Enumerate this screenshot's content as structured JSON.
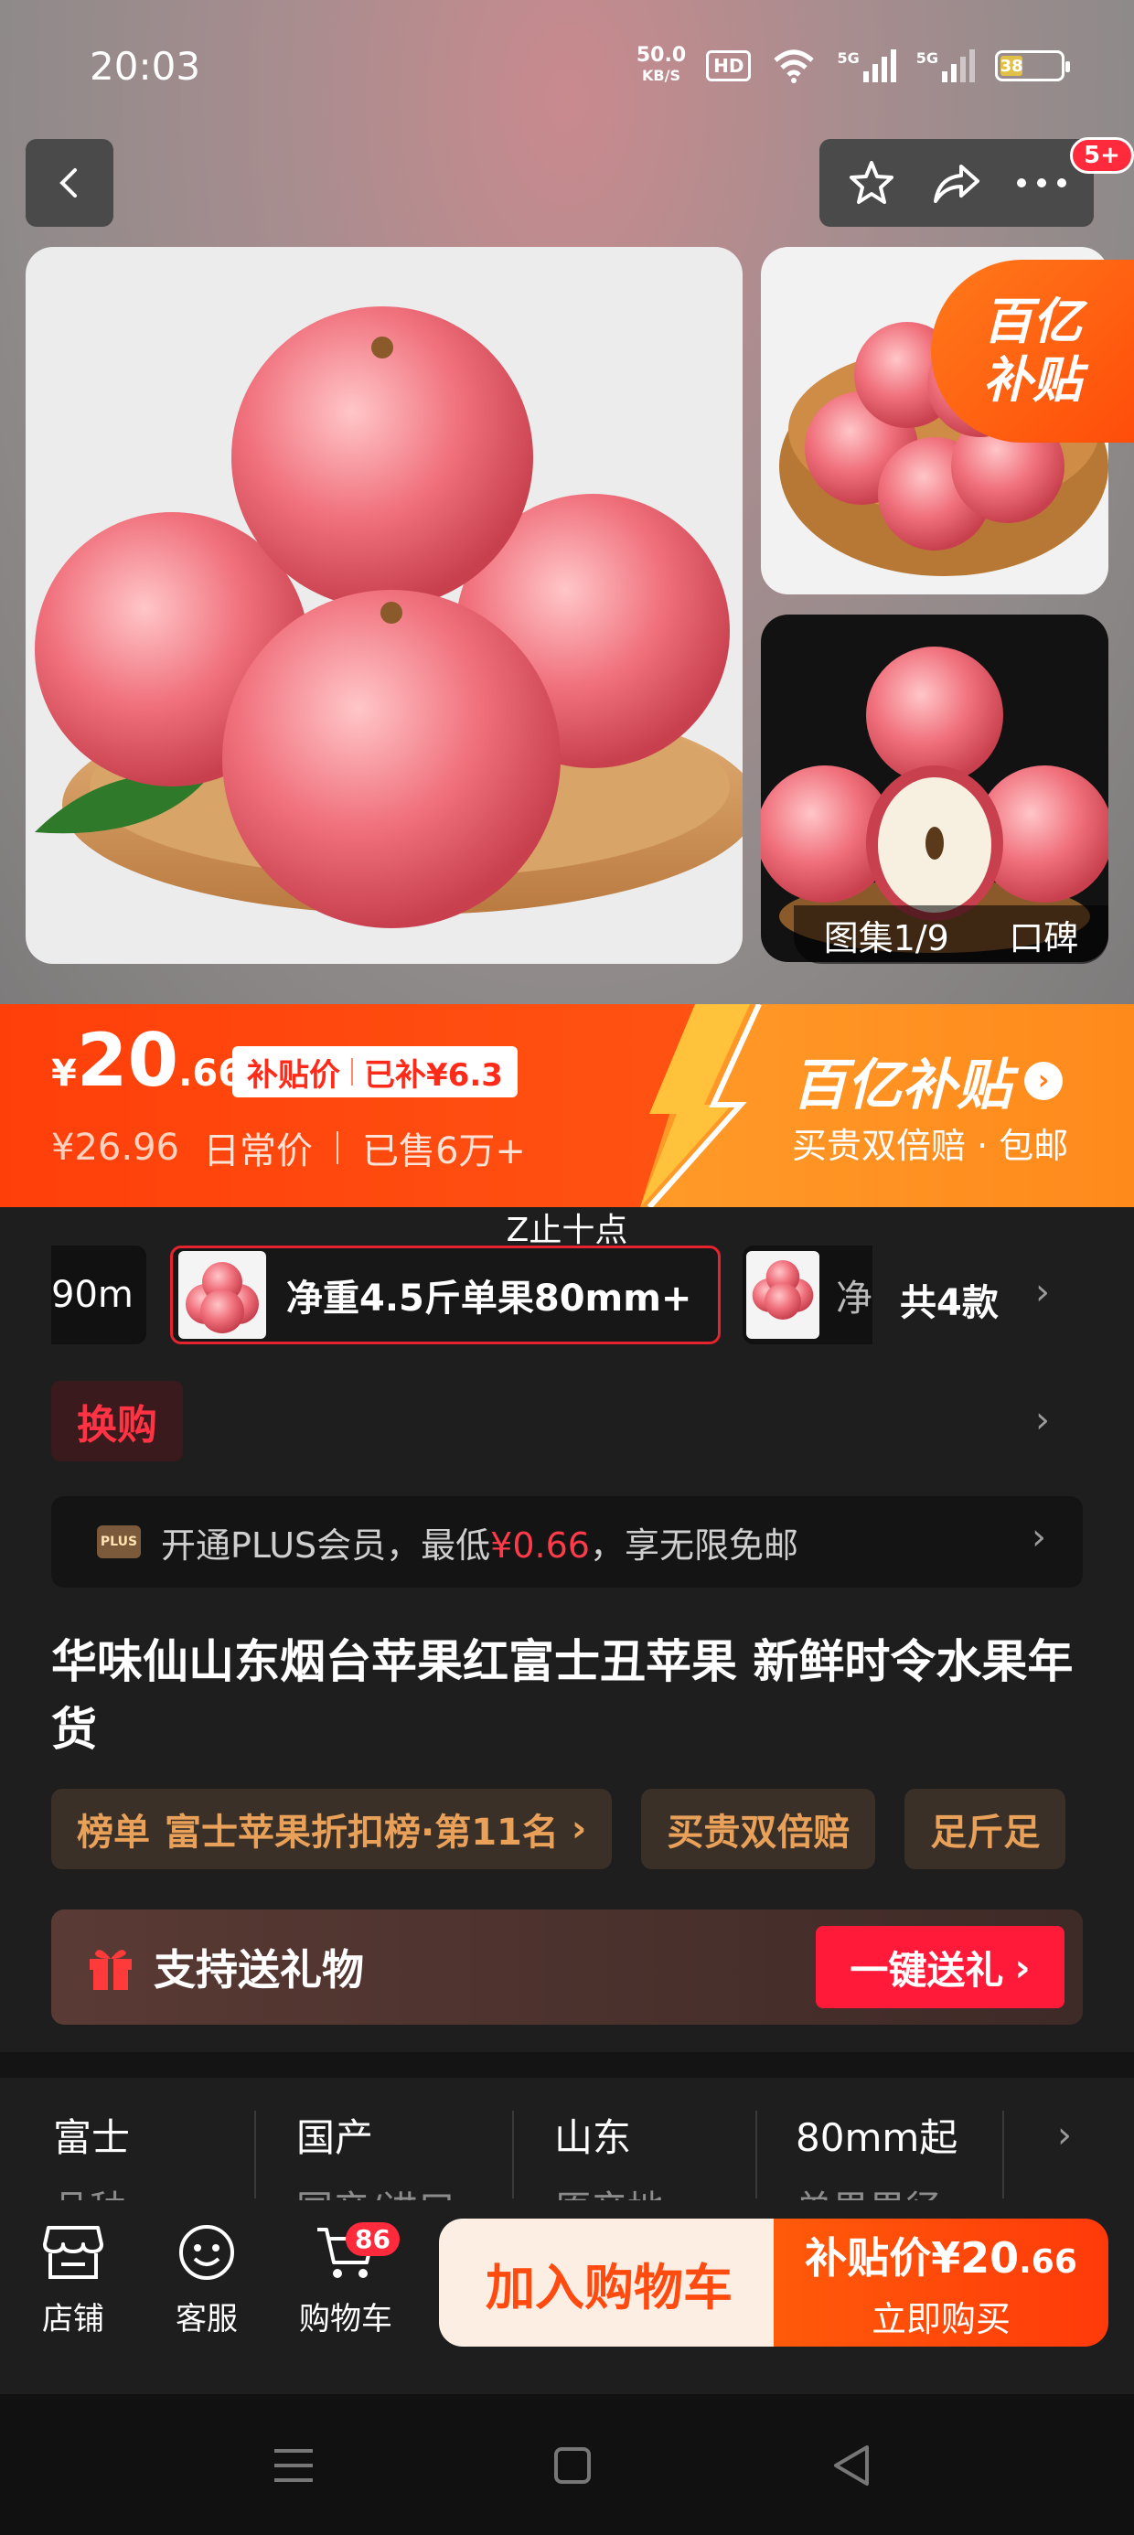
{
  "status_bar": {
    "time": "20:03",
    "net_speed": "50.0",
    "net_unit": "KB/S",
    "hd_label": "HD",
    "signal1": "5G",
    "signal2": "5G",
    "battery": "38",
    "battery_level": 0.38
  },
  "header": {
    "message_badge": "5+"
  },
  "gallery": {
    "subsidy_line1": "百亿",
    "subsidy_line2": "补贴",
    "album_label": "图集1/9",
    "reputation_label": "口碑"
  },
  "price": {
    "currency": "¥",
    "integer": "20",
    "decimal": ".66",
    "tag_label": "补贴价",
    "tag_saved": "已补¥6.3",
    "original": "¥26.96",
    "original_label": "日常价",
    "sold": "已售6万+",
    "program_title": "百亿补贴",
    "program_sub": "买贵双倍赔 · 包邮"
  },
  "specs": {
    "notice": "Z止十点",
    "prev_sku_partial": "90m",
    "selected_sku": "净重4.5斤单果80mm+",
    "next_sku_partial": "净",
    "total": "共4款"
  },
  "swap_label": "换购",
  "plus": {
    "icon_text": "PLUS",
    "text_before": "开通PLUS会员，最低",
    "highlight": "¥0.66",
    "text_after": "，享无限免邮"
  },
  "product_title": "华味仙山东烟台苹果红富士丑苹果 新鲜时令水果年货",
  "tags": {
    "rank_label": "榜单",
    "rank_text": "富士苹果折扣榜·第11名",
    "double_comp": "买贵双倍赔",
    "partial": "足斤足"
  },
  "gift": {
    "label": "支持送礼物",
    "button": "一键送礼"
  },
  "attributes": [
    {
      "value": "富士",
      "key": "品种"
    },
    {
      "value": "国产",
      "key": "国产/进口"
    },
    {
      "value": "山东",
      "key": "原产地"
    },
    {
      "value": "80mm起",
      "key": "单果果径"
    }
  ],
  "bottom_bar": {
    "shop": "店铺",
    "service": "客服",
    "cart": "购物车",
    "cart_count": "86",
    "add_to_cart": "加入购物车",
    "buy_price_label": "补贴价¥20",
    "buy_price_dec": ".66",
    "buy_now": "立即购买"
  },
  "colors": {
    "accent": "#ff4a10",
    "price_banner": "#ff3f0a",
    "highlight_red": "#ff3b4a",
    "tag_gold": "#e9a15a"
  }
}
